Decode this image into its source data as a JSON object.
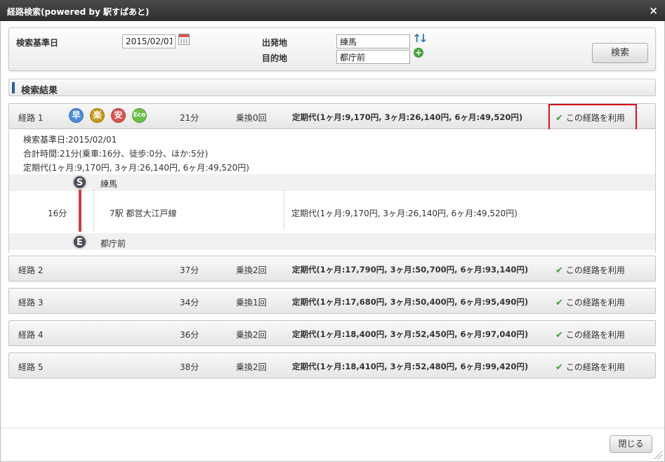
{
  "window": {
    "title": "経路検索(powered by 駅すぱあと)",
    "close_glyph": "×"
  },
  "search": {
    "date_label": "検索基準日",
    "date_value": "2015/02/01",
    "from_label": "出発地",
    "from_value": "練馬",
    "to_label": "目的地",
    "to_value": "都庁前",
    "search_button": "検索"
  },
  "results": {
    "header": "検索結果",
    "use_label": "この経路を利用",
    "badges": [
      "早",
      "楽",
      "安",
      "Eco"
    ],
    "routes": [
      {
        "name": "経路 1",
        "time": "21分",
        "transfer": "乗換0回",
        "fare": "定期代(1ヶ月:9,170円, 3ヶ月:26,140円, 6ヶ月:49,520円)"
      },
      {
        "name": "経路 2",
        "time": "37分",
        "transfer": "乗換2回",
        "fare": "定期代(1ヶ月:17,790円, 3ヶ月:50,700円, 6ヶ月:93,140円)"
      },
      {
        "name": "経路 3",
        "time": "34分",
        "transfer": "乗換1回",
        "fare": "定期代(1ヶ月:17,680円, 3ヶ月:50,400円, 6ヶ月:95,490円)"
      },
      {
        "name": "経路 4",
        "time": "36分",
        "transfer": "乗換2回",
        "fare": "定期代(1ヶ月:18,400円, 3ヶ月:52,450円, 6ヶ月:97,040円)"
      },
      {
        "name": "経路 5",
        "time": "38分",
        "transfer": "乗換2回",
        "fare": "定期代(1ヶ月:18,410円, 3ヶ月:52,480円, 6ヶ月:99,420円)"
      }
    ],
    "detail": {
      "base_date": "検索基準日:2015/02/01",
      "total_time": "合計時間:21分(乗車:16分、徒歩:0分、ほか:5分)",
      "fare": "定期代(1ヶ月:9,170円, 3ヶ月:26,140円, 6ヶ月:49,520円)",
      "start_marker": "S",
      "start_station": "練馬",
      "segment_time": "16分",
      "segment_line": "7駅  都営大江戸線",
      "segment_fare": "定期代(1ヶ月:9,170円, 3ヶ月:26,140円, 6ヶ月:49,520円)",
      "end_marker": "E",
      "end_station": "都庁前"
    }
  },
  "footer": {
    "close_button": "閉じる"
  }
}
